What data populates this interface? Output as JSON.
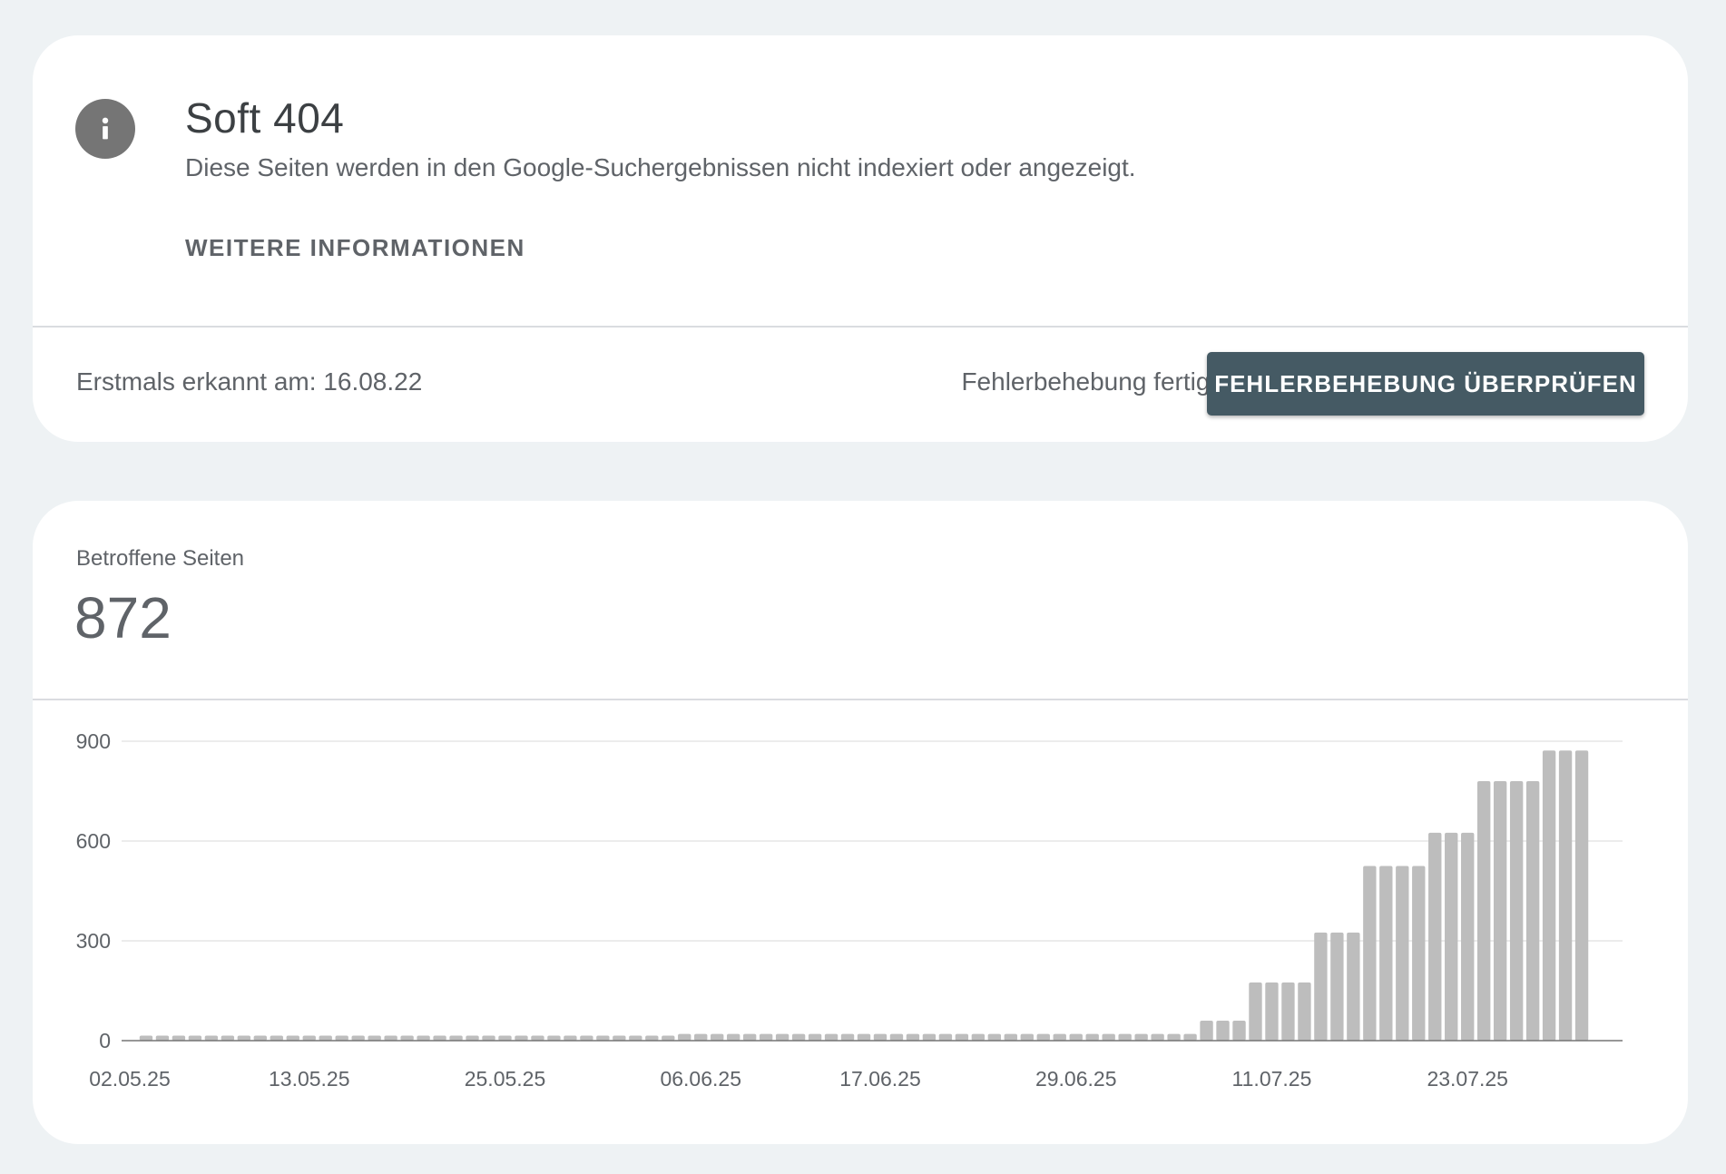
{
  "issue": {
    "title": "Soft 404",
    "description": "Diese Seiten werden in den Google-Suchergebnissen nicht indexiert oder angezeigt.",
    "more_info_label": "WEITERE INFORMATIONEN",
    "icon": "info-icon"
  },
  "status": {
    "first_detected": "Erstmals erkannt am: 16.08.22",
    "fix_question": "Fehlerbehebung fertig?",
    "validate_button": "FEHLERBEHEBUNG ÜBERPRÜFEN"
  },
  "affected": {
    "label": "Betroffene Seiten",
    "count": "872"
  },
  "colors": {
    "page_background": "#eef2f4",
    "button_background": "#455a64",
    "bar": "#bdbdbd",
    "info_icon": "#757575"
  },
  "chart_data": {
    "type": "bar",
    "title": "",
    "xlabel": "",
    "ylabel": "",
    "ylim": [
      0,
      900
    ],
    "yticks": [
      0,
      300,
      600,
      900
    ],
    "x_tick_labels": [
      "02.05.25",
      "13.05.25",
      "25.05.25",
      "06.06.25",
      "17.06.25",
      "29.06.25",
      "11.07.25",
      "23.07.25"
    ],
    "grid": true,
    "categories": [
      "02.05.25",
      "03.05.25",
      "04.05.25",
      "05.05.25",
      "06.05.25",
      "07.05.25",
      "08.05.25",
      "09.05.25",
      "10.05.25",
      "11.05.25",
      "12.05.25",
      "13.05.25",
      "14.05.25",
      "15.05.25",
      "16.05.25",
      "17.05.25",
      "18.05.25",
      "19.05.25",
      "20.05.25",
      "21.05.25",
      "22.05.25",
      "23.05.25",
      "24.05.25",
      "25.05.25",
      "26.05.25",
      "27.05.25",
      "28.05.25",
      "29.05.25",
      "30.05.25",
      "31.05.25",
      "01.06.25",
      "02.06.25",
      "03.06.25",
      "04.06.25",
      "05.06.25",
      "06.06.25",
      "07.06.25",
      "08.06.25",
      "09.06.25",
      "10.06.25",
      "11.06.25",
      "12.06.25",
      "13.06.25",
      "14.06.25",
      "15.06.25",
      "16.06.25",
      "17.06.25",
      "18.06.25",
      "19.06.25",
      "20.06.25",
      "21.06.25",
      "22.06.25",
      "23.06.25",
      "24.06.25",
      "25.06.25",
      "26.06.25",
      "27.06.25",
      "28.06.25",
      "29.06.25",
      "30.06.25",
      "01.07.25",
      "02.07.25",
      "03.07.25",
      "04.07.25",
      "05.07.25",
      "06.07.25",
      "07.07.25",
      "08.07.25",
      "09.07.25",
      "10.07.25",
      "11.07.25",
      "12.07.25",
      "13.07.25",
      "14.07.25",
      "15.07.25",
      "16.07.25",
      "17.07.25",
      "18.07.25",
      "19.07.25",
      "20.07.25",
      "21.07.25",
      "22.07.25",
      "23.07.25",
      "24.07.25",
      "25.07.25",
      "26.07.25",
      "27.07.25",
      "28.07.25",
      "29.07.25",
      "30.07.25",
      "31.07.25",
      "01.08.25"
    ],
    "values": [
      null,
      15,
      15,
      15,
      15,
      15,
      15,
      15,
      15,
      15,
      15,
      15,
      15,
      15,
      15,
      15,
      15,
      15,
      15,
      15,
      15,
      15,
      15,
      15,
      15,
      15,
      15,
      15,
      15,
      15,
      15,
      15,
      15,
      15,
      20,
      20,
      20,
      20,
      20,
      20,
      20,
      20,
      20,
      20,
      20,
      20,
      20,
      20,
      20,
      20,
      20,
      20,
      20,
      20,
      20,
      20,
      20,
      20,
      20,
      20,
      20,
      20,
      20,
      20,
      20,
      20,
      60,
      60,
      60,
      175,
      175,
      175,
      175,
      325,
      325,
      325,
      525,
      525,
      525,
      525,
      625,
      625,
      625,
      780,
      780,
      780,
      780,
      872,
      872,
      872,
      null,
      null
    ]
  }
}
